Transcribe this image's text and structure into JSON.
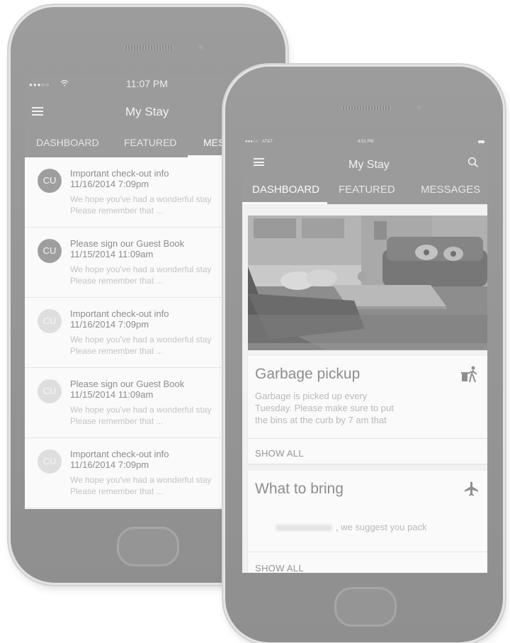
{
  "back_phone": {
    "status_time": "11:07 PM",
    "app_title": "My Stay",
    "tabs": [
      "DASHBOARD",
      "FEATURED",
      "MES"
    ],
    "messages": [
      {
        "avatar": "CU",
        "title": "Important check-out info",
        "date": "11/16/2014  7:09pm",
        "body": "We hope you've had a wonderful stay\nPlease remember that ..."
      },
      {
        "avatar": "CU",
        "title": "Please sign our Guest Book",
        "date": "11/15/2014  11:09am",
        "body": "We hope you've had a wonderful stay\nPlease remember that ..."
      },
      {
        "avatar": "CU",
        "title": "Important check-out info",
        "date": "11/16/2014  7:09pm",
        "body": "We hope you've had a wonderful stay\nPlease remember that ..."
      },
      {
        "avatar": "CU",
        "title": "Please sign our Guest Book",
        "date": "11/15/2014  11:09am",
        "body": "We hope you've had a wonderful stay\nPlease remember that ..."
      },
      {
        "avatar": "CU",
        "title": "Important check-out info",
        "date": "11/16/2014  7:09pm",
        "body": "We hope you've had a wonderful stay\nPlease remember that ..."
      }
    ]
  },
  "front_phone": {
    "status_carrier": "AT&T",
    "status_time": "4:51 PM",
    "app_title": "My Stay",
    "tabs": [
      "DASHBOARD",
      "FEATURED",
      "MESSAGES"
    ],
    "active_tab": "DASHBOARD",
    "cards": [
      {
        "title": "Garbage pickup",
        "icon": "trash-person-icon",
        "body": "Garbage is picked up every\nTuesday. Please make sure to put\nthe bins at the curb by 7 am that",
        "action": "SHOW ALL"
      },
      {
        "title": "What to bring",
        "icon": "airplane-icon",
        "body": ", we suggest you pack",
        "action": "SHOW ALL"
      }
    ]
  },
  "colors": {
    "app_bar": "#9b9b9b",
    "phone_body": "#939393",
    "screen_bg": "#fafafa"
  }
}
